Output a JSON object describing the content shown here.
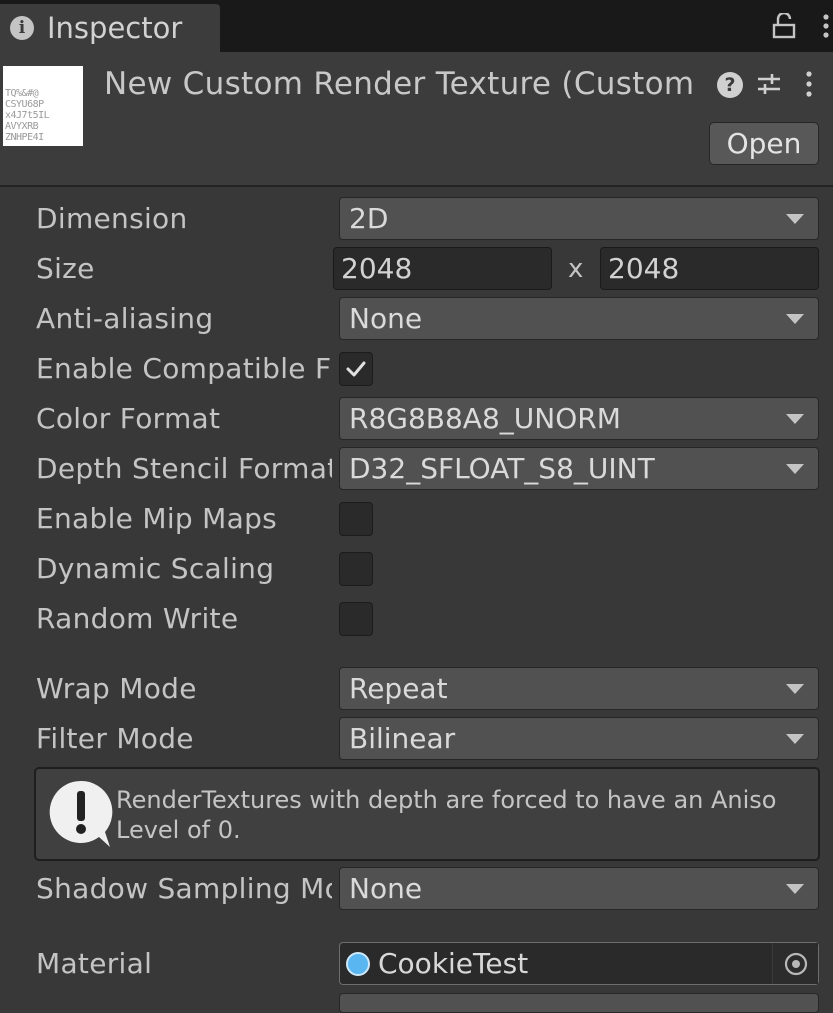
{
  "tab": {
    "title": "Inspector",
    "icon": "info-icon"
  },
  "header": {
    "title": "New Custom Render Texture (Custom R",
    "open_label": "Open",
    "thumb_text": [
      "TQ%&#@",
      "CSYU68P",
      "x4J7t5IL",
      "AVYXRB",
      "ZNHPE4I"
    ],
    "icons": [
      "help-icon",
      "presets-icon",
      "kebab-menu-icon"
    ]
  },
  "fields": {
    "dimension": {
      "label": "Dimension",
      "value": "2D"
    },
    "size": {
      "label": "Size",
      "width": "2048",
      "separator": "x",
      "height": "2048"
    },
    "anti_aliasing": {
      "label": "Anti-aliasing",
      "value": "None"
    },
    "compatible_format": {
      "label": "Enable Compatible Format",
      "checked": true
    },
    "color_format": {
      "label": "Color Format",
      "value": "R8G8B8A8_UNORM"
    },
    "depth_stencil": {
      "label": "Depth Stencil Format",
      "value": "D32_SFLOAT_S8_UINT"
    },
    "mip_maps": {
      "label": "Enable Mip Maps",
      "checked": false
    },
    "dynamic_scaling": {
      "label": "Dynamic Scaling",
      "checked": false
    },
    "random_write": {
      "label": "Random Write",
      "checked": false
    },
    "wrap_mode": {
      "label": "Wrap Mode",
      "value": "Repeat"
    },
    "filter_mode": {
      "label": "Filter Mode",
      "value": "Bilinear"
    },
    "shadow_sampling": {
      "label": "Shadow Sampling Mode",
      "value": "None"
    },
    "material": {
      "label": "Material",
      "value": "CookieTest"
    }
  },
  "helpbox": {
    "text": "RenderTextures with depth are forced to have an Aniso Level of 0."
  },
  "colors": {
    "background": "#383838",
    "tabbar": "#191919",
    "dropdown": "#515151",
    "field": "#2a2a2a",
    "accent": "#5ab6f0"
  }
}
